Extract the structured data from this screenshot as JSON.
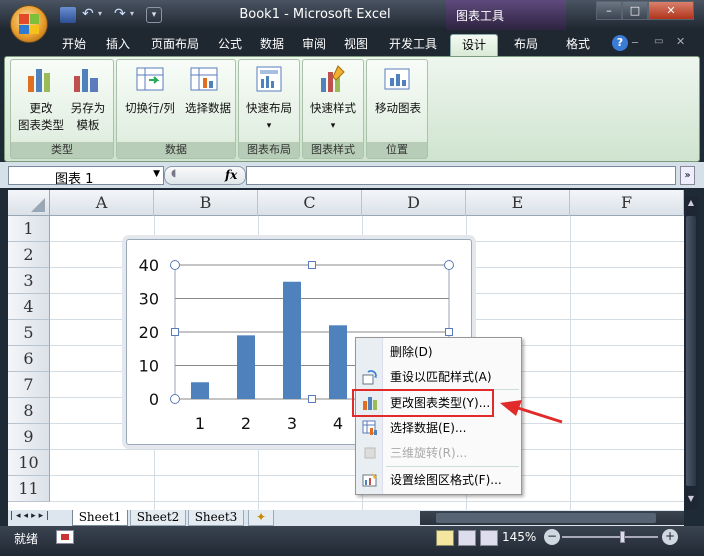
{
  "window": {
    "title": "Book1 - Microsoft Excel",
    "contextual_tools": "图表工具",
    "minimize": "–",
    "restore": "□",
    "close": "✕"
  },
  "ribbon": {
    "tabs": [
      "开始",
      "插入",
      "页面布局",
      "公式",
      "数据",
      "审阅",
      "视图",
      "开发工具",
      "设计",
      "布局",
      "格式"
    ],
    "active_tab": "设计",
    "groups": {
      "type": {
        "label": "类型",
        "change_chart_type_line1": "更改",
        "change_chart_type_line2": "图表类型",
        "save_template_line1": "另存为",
        "save_template_line2": "模板"
      },
      "data": {
        "label": "数据",
        "switch_row_col": "切换行/列",
        "select_data": "选择数据"
      },
      "layout": {
        "label": "图表布局",
        "quick_layout": "快速布局",
        "dropdown": "▾"
      },
      "style": {
        "label": "图表样式",
        "quick_style": "快速样式",
        "dropdown": "▾"
      },
      "location": {
        "label": "位置",
        "move_chart": "移动图表"
      }
    }
  },
  "formula_bar": {
    "name_box": "图表 1",
    "fx": "fx",
    "formula": ""
  },
  "grid": {
    "columns": [
      "A",
      "B",
      "C",
      "D",
      "E",
      "F"
    ],
    "rows": [
      "1",
      "2",
      "3",
      "4",
      "5",
      "6",
      "7",
      "8",
      "9",
      "10",
      "11"
    ]
  },
  "chart_data": {
    "type": "bar",
    "categories": [
      "1",
      "2",
      "3",
      "4"
    ],
    "values": [
      5,
      19,
      35,
      22
    ],
    "ylim": [
      0,
      40
    ],
    "yticks": [
      "0",
      "10",
      "20",
      "30",
      "40"
    ],
    "bar_color": "#4f81bd",
    "grid": true
  },
  "context_menu": {
    "items": [
      {
        "label": "删除(D)",
        "icon": "none",
        "enabled": true
      },
      {
        "label": "重设以匹配样式(A)",
        "icon": "reset-style-icon",
        "enabled": true
      },
      {
        "label": "更改图表类型(Y)...",
        "icon": "chart-type-icon",
        "enabled": true
      },
      {
        "label": "选择数据(E)...",
        "icon": "select-data-icon",
        "enabled": true
      },
      {
        "label": "三维旋转(R)...",
        "icon": "rotation-icon",
        "enabled": false
      },
      {
        "label": "设置绘图区格式(F)...",
        "icon": "format-icon",
        "enabled": true
      }
    ]
  },
  "sheet_tabs": [
    "Sheet1",
    "Sheet2",
    "Sheet3"
  ],
  "status": {
    "ready": "就绪",
    "zoom": "145%"
  },
  "colors": {
    "highlight": "#e12b2b",
    "ribbon_green": "#dbebdb",
    "bar": "#4f81bd"
  }
}
